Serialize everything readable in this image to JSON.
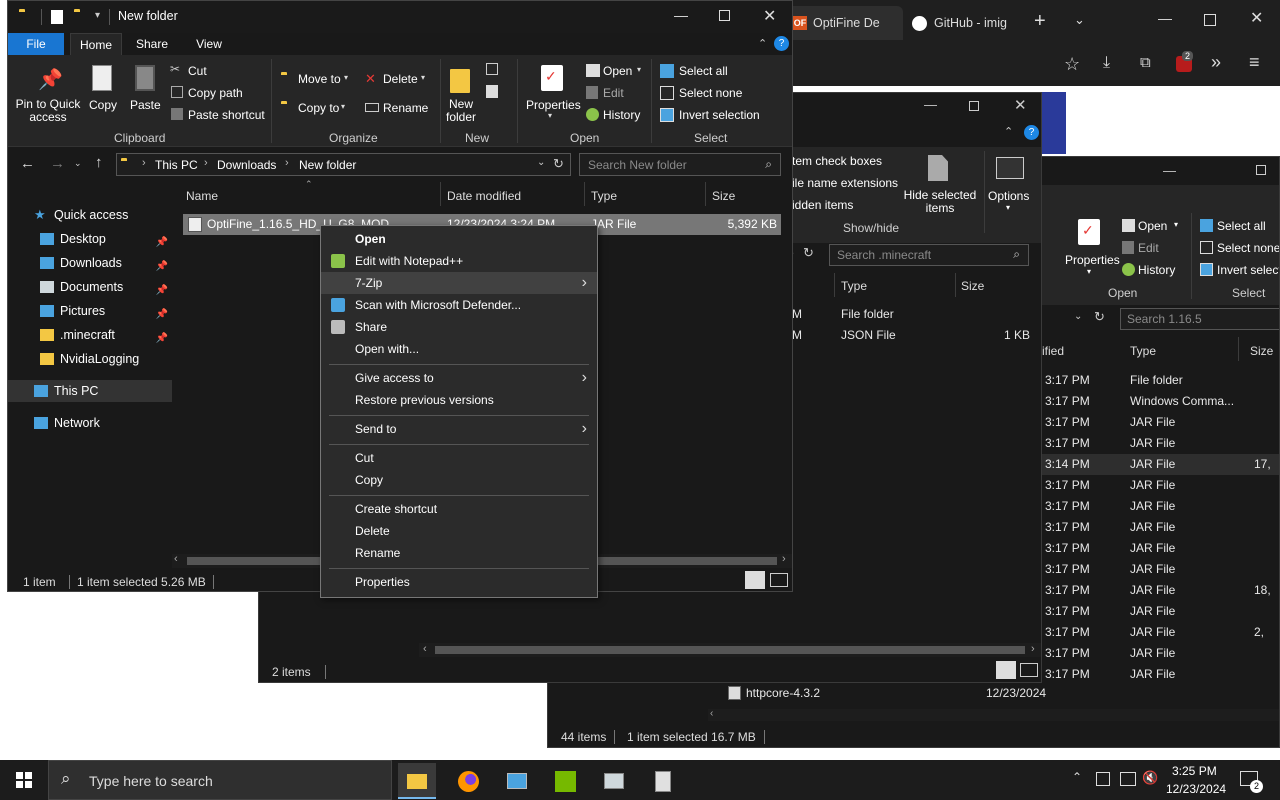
{
  "browser": {
    "tabs": [
      {
        "label": "OptiFine De",
        "icon": "optifine-icon"
      },
      {
        "label": "GitHub - imig",
        "icon": "github-icon"
      }
    ],
    "extension_badge": "2"
  },
  "main_window": {
    "title": "New folder",
    "ribbon_tabs": [
      "File",
      "Home",
      "Share",
      "View"
    ],
    "clipboard": {
      "pin": "Pin to Quick access",
      "copy": "Copy",
      "paste": "Paste",
      "cut": "Cut",
      "copy_path": "Copy path",
      "paste_shortcut": "Paste shortcut",
      "group": "Clipboard"
    },
    "organize": {
      "move_to": "Move to",
      "delete": "Delete",
      "copy_to": "Copy to",
      "rename": "Rename",
      "group": "Organize"
    },
    "new": {
      "new_folder": "New folder",
      "group": "New"
    },
    "open": {
      "properties": "Properties",
      "open": "Open",
      "edit": "Edit",
      "history": "History",
      "group": "Open"
    },
    "select": {
      "select_all": "Select all",
      "select_none": "Select none",
      "invert": "Invert selection",
      "group": "Select"
    },
    "breadcrumb": [
      "This PC",
      "Downloads",
      "New folder"
    ],
    "search_placeholder": "Search New folder",
    "columns": [
      "Name",
      "Date modified",
      "Type",
      "Size"
    ],
    "file": {
      "name": "OptiFine_1.16.5_HD_U_G8_MOD",
      "date": "12/23/2024 3:24 PM",
      "type": "JAR File",
      "size": "5,392 KB"
    },
    "sidebar": [
      {
        "label": "Quick access",
        "icon": "star-icon",
        "pinned": false
      },
      {
        "label": "Desktop",
        "icon": "desktop-icon",
        "pinned": true
      },
      {
        "label": "Downloads",
        "icon": "download-icon",
        "pinned": true
      },
      {
        "label": "Documents",
        "icon": "document-icon",
        "pinned": true
      },
      {
        "label": "Pictures",
        "icon": "pictures-icon",
        "pinned": true
      },
      {
        "label": ".minecraft",
        "icon": "folder-icon",
        "pinned": true
      },
      {
        "label": "NvidiaLogging",
        "icon": "folder-icon",
        "pinned": false
      },
      {
        "label": "This PC",
        "icon": "pc-icon",
        "pinned": false
      },
      {
        "label": "Network",
        "icon": "network-icon",
        "pinned": false
      }
    ],
    "status": {
      "count": "1 item",
      "selected": "1 item selected  5.26 MB"
    }
  },
  "context_menu": {
    "items": [
      {
        "label": "Open",
        "bold": true
      },
      {
        "label": "Edit with Notepad++",
        "icon": "notepad-icon"
      },
      {
        "label": "7-Zip",
        "submenu": true,
        "highlight": true
      },
      {
        "label": "Scan with Microsoft Defender...",
        "icon": "defender-icon"
      },
      {
        "label": "Share",
        "icon": "share-icon"
      },
      {
        "label": "Open with..."
      },
      {
        "label": "Give access to",
        "submenu": true
      },
      {
        "label": "Restore previous versions"
      },
      {
        "label": "Send to",
        "submenu": true
      },
      {
        "label": "Cut"
      },
      {
        "label": "Copy"
      },
      {
        "label": "Create shortcut"
      },
      {
        "label": "Delete"
      },
      {
        "label": "Rename"
      },
      {
        "label": "Properties"
      }
    ]
  },
  "mid_window": {
    "view_options": {
      "item_checkboxes": "tem check boxes",
      "extensions": "ile name extensions",
      "hidden": "idden items",
      "hide_selected": "Hide selected items",
      "options": "Options",
      "group": "Show/hide"
    },
    "search_placeholder": "Search .minecraft",
    "columns": [
      "Type",
      "Size"
    ],
    "rows": [
      {
        "date": "M",
        "type": "File folder",
        "size": ""
      },
      {
        "date": "M",
        "type": "JSON File",
        "size": "1 KB"
      }
    ],
    "status": "2 items"
  },
  "back_window": {
    "open": {
      "properties": "Properties",
      "open": "Open",
      "edit": "Edit",
      "history": "History",
      "group": "Open"
    },
    "select": {
      "select_all": "Select all",
      "select_none": "Select none",
      "invert": "Invert selecti",
      "group": "Select"
    },
    "search_placeholder": "Search 1.16.5",
    "columns": [
      "ified",
      "Type",
      "Size"
    ],
    "rows": [
      {
        "time": "3:17 PM",
        "type": "File folder",
        "size": ""
      },
      {
        "time": "3:17 PM",
        "type": "Windows Comma...",
        "size": ""
      },
      {
        "time": "3:17 PM",
        "type": "JAR File",
        "size": ""
      },
      {
        "time": "3:17 PM",
        "type": "JAR File",
        "size": ""
      },
      {
        "time": "3:14 PM",
        "type": "JAR File",
        "size": "17,"
      },
      {
        "time": "3:17 PM",
        "type": "JAR File",
        "size": ""
      },
      {
        "time": "3:17 PM",
        "type": "JAR File",
        "size": ""
      },
      {
        "time": "3:17 PM",
        "type": "JAR File",
        "size": ""
      },
      {
        "time": "3:17 PM",
        "type": "JAR File",
        "size": ""
      },
      {
        "time": "3:17 PM",
        "type": "JAR File",
        "size": ""
      },
      {
        "time": "3:17 PM",
        "type": "JAR File",
        "size": "18,"
      },
      {
        "time": "3:17 PM",
        "type": "JAR File",
        "size": ""
      },
      {
        "time": "3:17 PM",
        "type": "JAR File",
        "size": "2,"
      },
      {
        "time": "3:17 PM",
        "type": "JAR File",
        "size": ""
      },
      {
        "time": "3:17 PM",
        "type": "JAR File",
        "size": ""
      }
    ],
    "last_name": "httpcore-4.3.2",
    "last_date": "12/23/2024",
    "status": {
      "count": "44 items",
      "selected": "1 item selected  16.7 MB"
    }
  },
  "taskbar": {
    "search_placeholder": "Type here to search",
    "time": "3:25 PM",
    "date": "12/23/2024",
    "notification_count": "2"
  }
}
